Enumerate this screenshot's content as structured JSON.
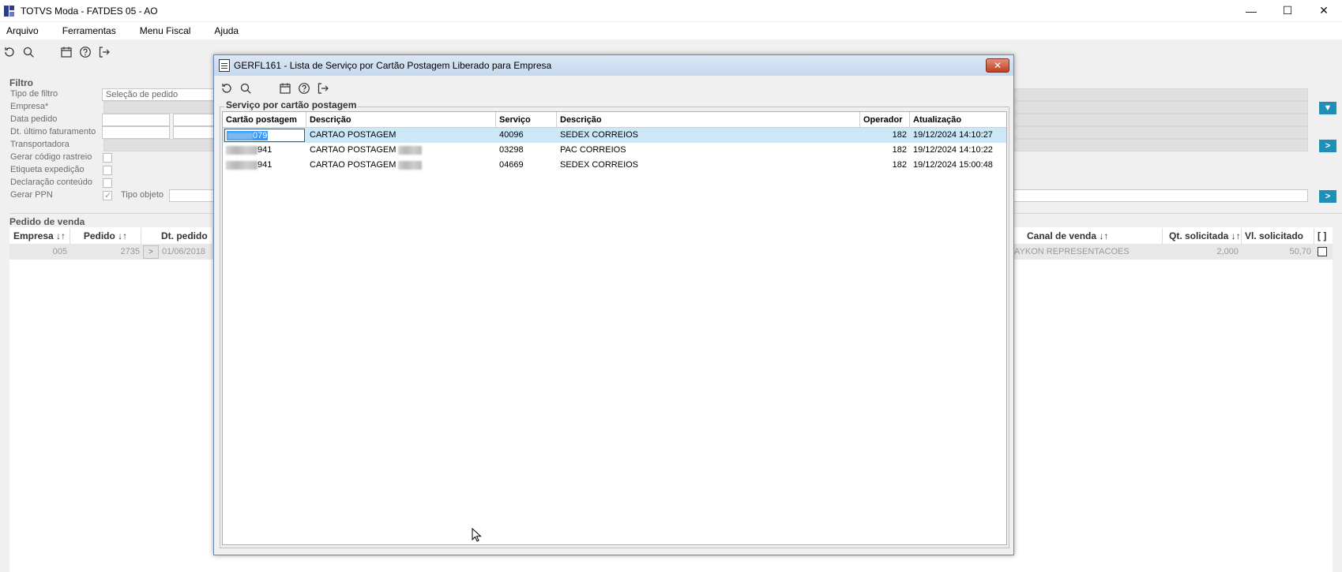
{
  "window": {
    "title": "TOTVS Moda - FATDES 05 - AO"
  },
  "menu": {
    "items": [
      "Arquivo",
      "Ferramentas",
      "Menu Fiscal",
      "Ajuda"
    ]
  },
  "toolbar_icons": [
    "refresh-icon",
    "search-icon",
    "calendar-icon",
    "help-icon",
    "exit-icon"
  ],
  "filter": {
    "title": "Filtro",
    "labels": [
      "Tipo de filtro",
      "Empresa*",
      "Data pedido",
      "Dt. último faturamento",
      "Transportadora",
      "Gerar código rastreio",
      "Etiqueta expedição",
      "Declaração conteúdo",
      "Gerar PPN"
    ],
    "tipo_filtro_value": "Seleção de pedido",
    "tipo_objeto_label": "Tipo objeto"
  },
  "pedido": {
    "title": "Pedido de venda",
    "headers": {
      "empresa": "Empresa ↓↑",
      "pedido": "Pedido ↓↑",
      "dt_pedido": "Dt. pedido ↓",
      "canal": "Canal de venda ↓↑",
      "qt": "Qt. solicitada ↓↑",
      "vl": "Vl. solicitado ↓↑",
      "sel": "[ ]"
    },
    "row": {
      "empresa": "005",
      "pedido": "2735",
      "btn": ">",
      "dt_pedido": "01/06/2018",
      "canal": "AYKON REPRESENTACOES",
      "qt": "2,000",
      "vl": "50,70"
    }
  },
  "dialog": {
    "title": "GERFL161 - Lista de Serviço por Cartão Postagem Liberado para Empresa",
    "close_label": "✕",
    "group_title": "Serviço por cartão postagem",
    "columns": [
      "Cartão postagem",
      "Descrição",
      "Serviço",
      "Descrição",
      "Operador",
      "Atualização"
    ],
    "rows": [
      {
        "cartao": "079",
        "descricao": "CARTAO POSTAGEM",
        "servico": "40096",
        "descricao_servico": "SEDEX CORREIOS",
        "operador": "182",
        "atualizacao": "19/12/2024 14:10:27",
        "selected": true
      },
      {
        "cartao": "941",
        "descricao": "CARTAO POSTAGEM",
        "servico": "03298",
        "descricao_servico": "PAC CORREIOS",
        "operador": "182",
        "atualizacao": "19/12/2024 14:10:22",
        "selected": false
      },
      {
        "cartao": "941",
        "descricao": "CARTAO POSTAGEM",
        "servico": "04669",
        "descricao_servico": "SEDEX CORREIOS",
        "operador": "182",
        "atualizacao": "19/12/2024 15:00:48",
        "selected": false
      }
    ]
  }
}
